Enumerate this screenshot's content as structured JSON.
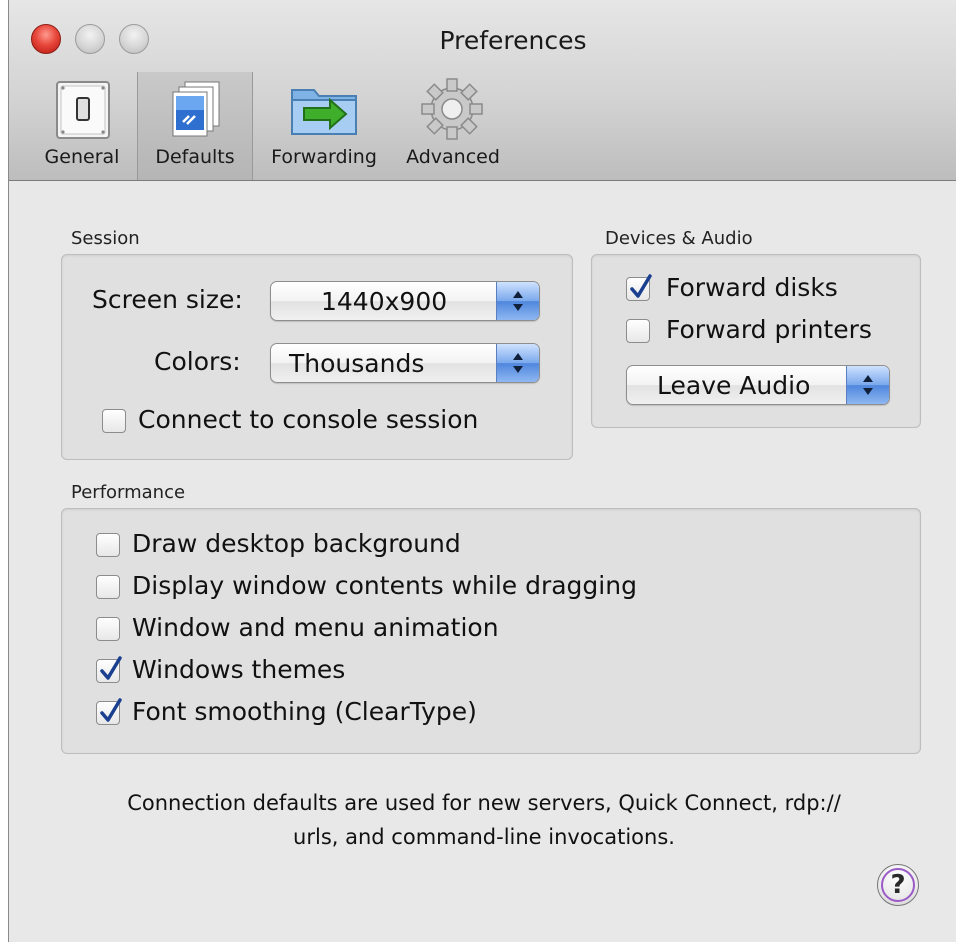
{
  "window": {
    "title": "Preferences"
  },
  "toolbar": {
    "items": [
      {
        "label": "General",
        "icon": "switch-icon",
        "selected": false
      },
      {
        "label": "Defaults",
        "icon": "documents-icon",
        "selected": true
      },
      {
        "label": "Forwarding",
        "icon": "folder-arrow-icon",
        "selected": false
      },
      {
        "label": "Advanced",
        "icon": "gear-icon",
        "selected": false
      }
    ]
  },
  "session": {
    "group_label": "Session",
    "screen_size_label": "Screen size:",
    "screen_size_value": "1440x900",
    "colors_label": "Colors:",
    "colors_value": "Thousands",
    "console": {
      "label": "Connect to console session",
      "checked": false
    }
  },
  "devices": {
    "group_label": "Devices & Audio",
    "forward_disks": {
      "label": "Forward disks",
      "checked": true
    },
    "forward_printers": {
      "label": "Forward printers",
      "checked": false
    },
    "audio_value": "Leave Audio"
  },
  "performance": {
    "group_label": "Performance",
    "options": [
      {
        "label": "Draw desktop background",
        "checked": false
      },
      {
        "label": "Display window contents while dragging",
        "checked": false
      },
      {
        "label": "Window and menu animation",
        "checked": false
      },
      {
        "label": "Windows themes",
        "checked": true
      },
      {
        "label": "Font smoothing (ClearType)",
        "checked": true
      }
    ]
  },
  "footer": {
    "line1": "Connection defaults are used for new servers, Quick Connect, rdp://",
    "line2": "urls, and command-line invocations.",
    "help_symbol": "?"
  },
  "colors": {
    "accent": "#4f86dc",
    "check": "#1a3f8f",
    "help_ring": "#9b5bc7"
  }
}
